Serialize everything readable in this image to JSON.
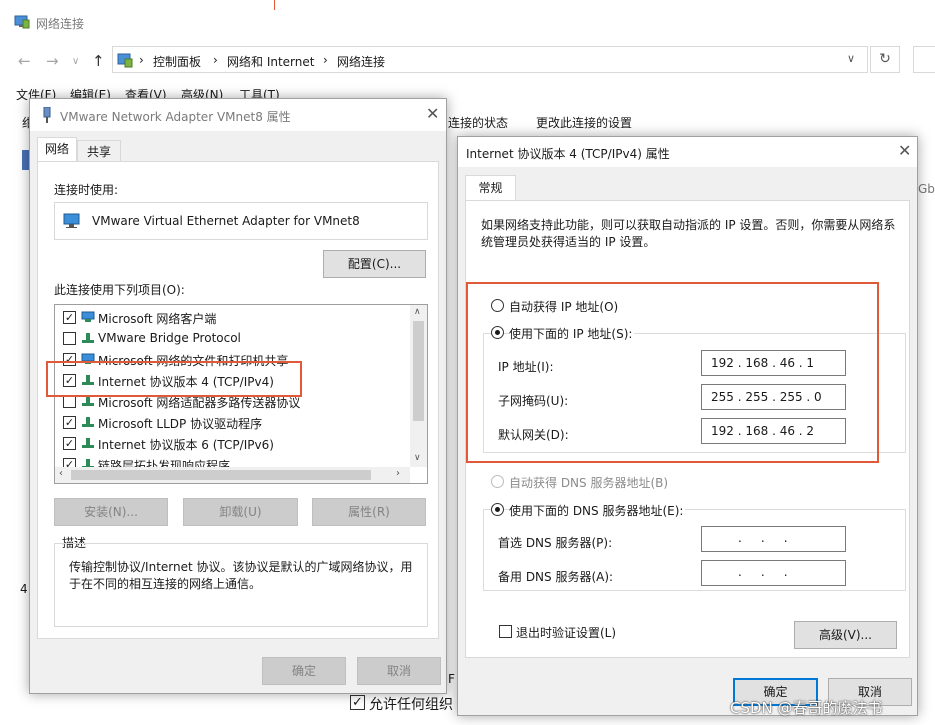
{
  "explorer": {
    "title": "网络连接",
    "breadcrumb": [
      "控制面板",
      "网络和 Internet",
      "网络连接"
    ],
    "menu": [
      "文件(F)",
      "编辑(E)",
      "查看(V)",
      "高级(N)",
      "工具(T)"
    ],
    "commands": [
      "绀",
      "连接的状态",
      "更改此连接的设置"
    ],
    "side_digit": "4",
    "right_fragment": "Gb",
    "allow_label": "允许任何组织",
    "f_fragment": "F"
  },
  "adapter_dialog": {
    "title": "VMware Network Adapter VMnet8 属性",
    "tabs": [
      "网络",
      "共享"
    ],
    "connect_using_label": "连接时使用:",
    "adapter_name": "VMware Virtual Ethernet Adapter for VMnet8",
    "configure_button": "配置(C)...",
    "items_label": "此连接使用下列项目(O):",
    "items": [
      {
        "label": "Microsoft 网络客户端",
        "checked": true,
        "icon": "network-client-icon"
      },
      {
        "label": "VMware Bridge Protocol",
        "checked": false,
        "icon": "protocol-icon"
      },
      {
        "label": "Microsoft 网络的文件和打印机共享",
        "checked": true,
        "icon": "file-share-icon"
      },
      {
        "label": "Internet 协议版本 4 (TCP/IPv4)",
        "checked": true,
        "icon": "protocol-icon"
      },
      {
        "label": "Microsoft 网络适配器多路传送器协议",
        "checked": false,
        "icon": "protocol-icon"
      },
      {
        "label": "Microsoft LLDP 协议驱动程序",
        "checked": true,
        "icon": "protocol-icon"
      },
      {
        "label": "Internet 协议版本 6 (TCP/IPv6)",
        "checked": true,
        "icon": "protocol-icon"
      },
      {
        "label": "链路层拓扑发现响应程序",
        "checked": true,
        "icon": "protocol-icon"
      }
    ],
    "install_button": "安装(N)...",
    "uninstall_button": "卸载(U)",
    "properties_button": "属性(R)",
    "description_label": "描述",
    "description": "传输控制协议/Internet 协议。该协议是默认的广域网络协议，用于在不同的相互连接的网络上通信。",
    "ok_button": "确定",
    "cancel_button": "取消"
  },
  "ipv4_dialog": {
    "title": "Internet 协议版本 4 (TCP/IPv4) 属性",
    "tab": "常规",
    "intro": "如果网络支持此功能，则可以获取自动指派的 IP 设置。否则，你需要从网络系统管理员处获得适当的 IP 设置。",
    "auto_ip_label": "自动获得 IP 地址(O)",
    "manual_ip_label": "使用下面的 IP 地址(S):",
    "ip_label": "IP 地址(I):",
    "ip_value": "192 . 168 . 46 . 1",
    "mask_label": "子网掩码(U):",
    "mask_value": "255 . 255 . 255 . 0",
    "gateway_label": "默认网关(D):",
    "gateway_value": "192 . 168 . 46 . 2",
    "auto_dns_label": "自动获得 DNS 服务器地址(B)",
    "manual_dns_label": "使用下面的 DNS 服务器地址(E):",
    "dns1_label": "首选 DNS 服务器(P):",
    "dns1_value": ".     .     .",
    "dns2_label": "备用 DNS 服务器(A):",
    "dns2_value": ".     .     .",
    "validate_label": "退出时验证设置(L)",
    "advanced_button": "高级(V)...",
    "ok_button": "确定",
    "cancel_button": "取消"
  },
  "watermark": "CSDN @春哥的魔法书",
  "colors": {
    "highlight_box": "#e05a3a",
    "accent": "#0078d7"
  }
}
